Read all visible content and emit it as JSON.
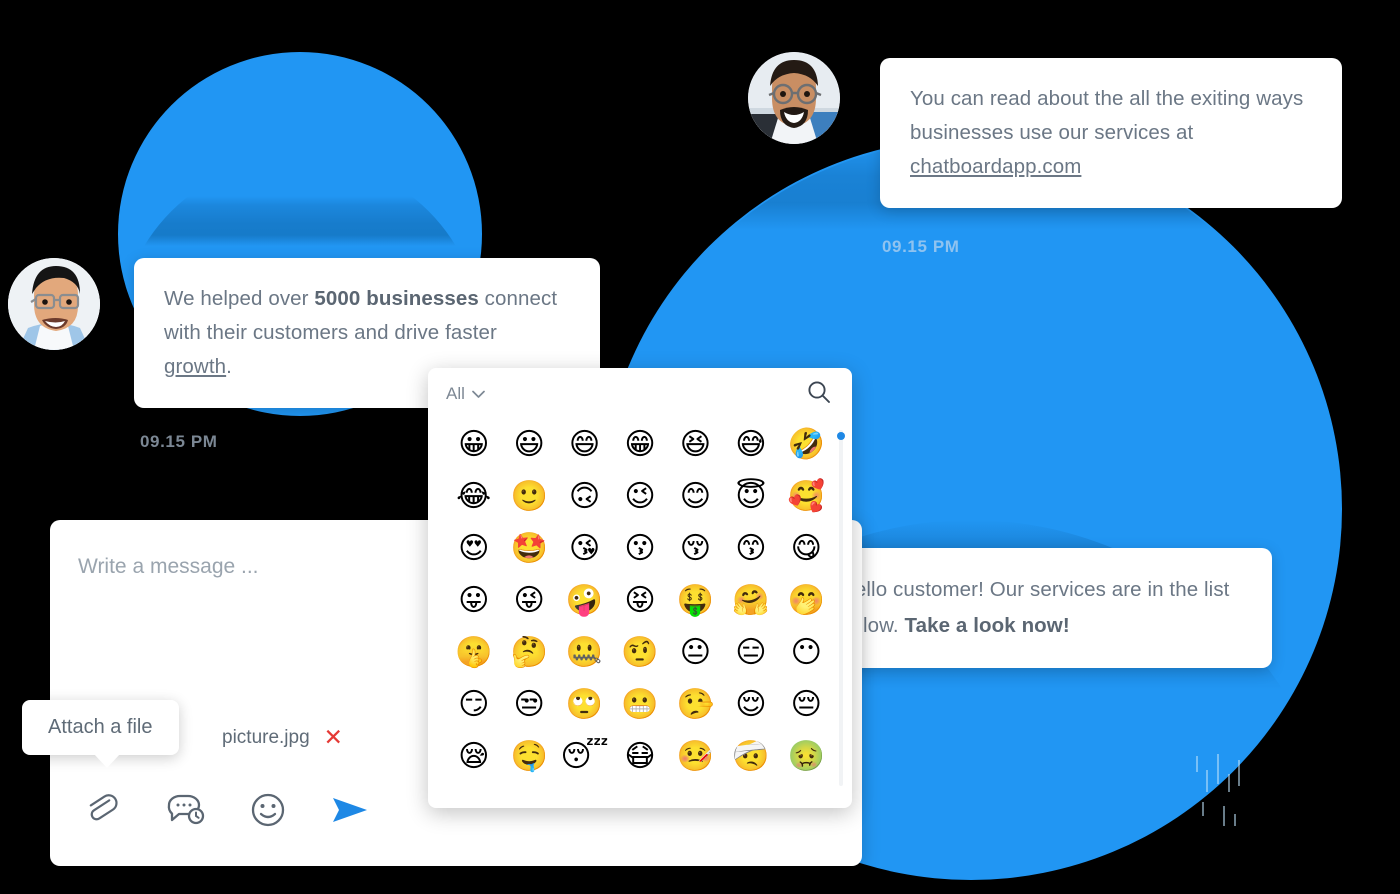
{
  "theme": {
    "accent_blue": "#2196f3",
    "send_blue": "#1e88e5",
    "text_gray": "#6b7785",
    "remove_red": "#e53935",
    "timestamp_left_color": "#7b8794",
    "timestamp_right_color": "#8fc3f0"
  },
  "messages": [
    {
      "id": "top-right",
      "sender": "agent",
      "text_before_link": "You can read about the all the exiting ways businesses use our services at ",
      "link_text": "chatboardapp.com",
      "timestamp": "09.15 PM"
    },
    {
      "id": "left",
      "sender": "customer",
      "part_1": "We helped over ",
      "bold_1": "5000 businesses",
      "part_2": " connect with their customers and drive faster ",
      "underline_1": "growth",
      "part_3": ".",
      "timestamp": "09.15 PM"
    },
    {
      "id": "bottom-right",
      "sender": "agent",
      "part_1": "Hello customer! Our services are in the list below. ",
      "bold_1": "Take a look now!"
    }
  ],
  "composer": {
    "input_placeholder": "Write a message ...",
    "input_value": "",
    "attachment": {
      "file_name": "picture.jpg",
      "remove_label": "✕"
    },
    "tooltip": {
      "attach_label": "Attach a file"
    },
    "tools": [
      {
        "name": "attach-file",
        "icon": "paperclip-icon"
      },
      {
        "name": "quick-reply",
        "icon": "chat-clock-icon"
      },
      {
        "name": "emoji-picker",
        "icon": "smiley-icon"
      },
      {
        "name": "send-message",
        "icon": "send-icon"
      }
    ]
  },
  "emoji_picker": {
    "category_label": "All",
    "category_caret": "⌄",
    "search_icon": "search-icon",
    "rows": [
      [
        "😀",
        "😃",
        "😄",
        "😁",
        "😆",
        "😅",
        "🤣"
      ],
      [
        "😂",
        "🙂",
        "🙃",
        "😉",
        "😊",
        "😇",
        "🥰"
      ],
      [
        "😍",
        "🤩",
        "😘",
        "😗",
        "😚",
        "😙",
        "😋"
      ],
      [
        "😛",
        "😜",
        "🤪",
        "😝",
        "🤑",
        "🤗",
        "🤭"
      ],
      [
        "🤫",
        "🤔",
        "🤐",
        "🤨",
        "😐",
        "😑",
        "😶"
      ],
      [
        "😏",
        "😒",
        "🙄",
        "😬",
        "🤥",
        "😌",
        "😔"
      ],
      [
        "😪",
        "🤤",
        "😴",
        "😷",
        "🤒",
        "🤕",
        "🤢"
      ]
    ]
  }
}
